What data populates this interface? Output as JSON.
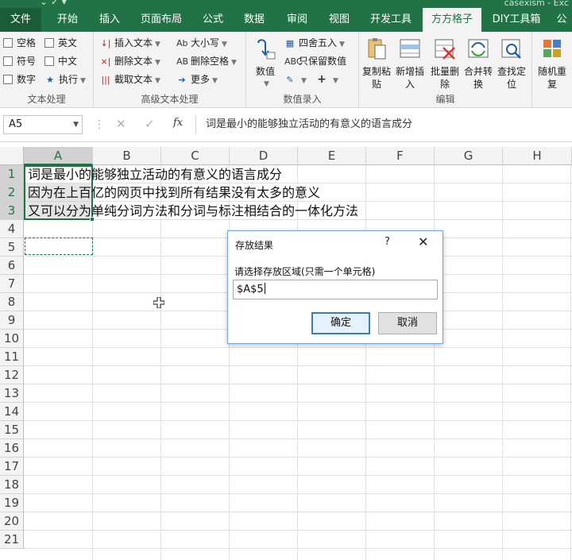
{
  "window": {
    "title_fragment": "casexism - Exc"
  },
  "tabs": [
    {
      "label": "文件",
      "key": "file"
    },
    {
      "label": "开始",
      "key": "home"
    },
    {
      "label": "插入",
      "key": "insert"
    },
    {
      "label": "页面布局",
      "key": "page-layout"
    },
    {
      "label": "公式",
      "key": "formulas"
    },
    {
      "label": "数据",
      "key": "data"
    },
    {
      "label": "审阅",
      "key": "review"
    },
    {
      "label": "视图",
      "key": "view"
    },
    {
      "label": "开发工具",
      "key": "developer"
    },
    {
      "label": "方方格子",
      "key": "ffgz",
      "active": true
    },
    {
      "label": "DIY工具箱",
      "key": "diy"
    },
    {
      "label": "公",
      "key": "more"
    }
  ],
  "ribbon": {
    "text_group": {
      "label": "文本处理",
      "items": [
        "空格",
        "英文",
        "符号",
        "中文",
        "数字",
        "执行"
      ]
    },
    "advanced_group": {
      "label": "高级文本处理",
      "items": [
        "插入文本",
        "删除文本",
        "截取文本",
        "大小写",
        "删除空格",
        "更多"
      ]
    },
    "number_group": {
      "label": "数值录入",
      "value_btn": "数值",
      "round_label": "四舍五入",
      "keep_value_label": "只保留数值"
    },
    "edit_group": {
      "label": "编辑",
      "buttons": [
        {
          "top": "复制粘",
          "bottom": "贴"
        },
        {
          "top": "新增插",
          "bottom": "入"
        },
        {
          "top": "批量删",
          "bottom": "除"
        },
        {
          "top": "合并转",
          "bottom": "换"
        },
        {
          "top": "查找定",
          "bottom": "位"
        }
      ]
    },
    "random_btn": {
      "top": "随机重",
      "bottom": "复"
    }
  },
  "formula_bar": {
    "name_box": "A5",
    "fx": "fx",
    "content": "词是最小的能够独立活动的有意义的语言成分"
  },
  "sheet": {
    "columns": [
      "A",
      "B",
      "C",
      "D",
      "E",
      "F",
      "G",
      "H"
    ],
    "rows": [
      "1",
      "2",
      "3",
      "4",
      "5",
      "6",
      "7",
      "8",
      "9",
      "10",
      "11",
      "12",
      "13",
      "14",
      "15",
      "16",
      "17",
      "18",
      "19",
      "20",
      "21"
    ],
    "cells": [
      "词是最小的能够独立活动的有意义的语言成分",
      "因为在上百亿的网页中找到所有结果没有太多的意义",
      "又可以分为单纯分词方法和分词与标注相结合的一体化方法"
    ]
  },
  "dialog": {
    "title": "存放结果",
    "help": "?",
    "close": "✕",
    "prompt": "请选择存放区域(只需一个单元格)",
    "value": "$A$5",
    "ok_label": "确定",
    "cancel_label": "取消"
  }
}
